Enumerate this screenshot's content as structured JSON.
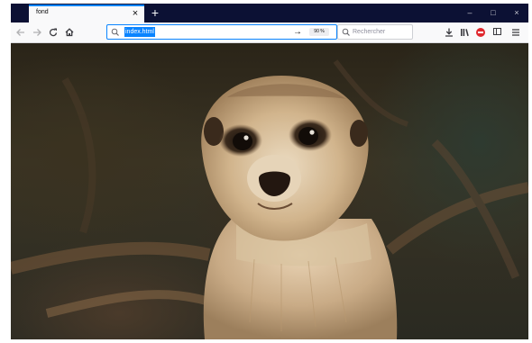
{
  "browser": {
    "tab": {
      "title": "fond",
      "close_label": "×"
    },
    "new_tab_label": "+",
    "window_controls": {
      "minimize": "–",
      "maximize": "□",
      "close": "×"
    },
    "nav": {
      "back_icon": "arrow-left-icon",
      "forward_icon": "arrow-right-icon",
      "reload_icon": "reload-icon",
      "home_icon": "home-icon"
    },
    "urlbar": {
      "value": "index.html",
      "go_label": "→",
      "zoom": "90 %"
    },
    "searchbar": {
      "placeholder": "Rechercher"
    },
    "toolbar": {
      "download_label": "⤓",
      "library_label": "⫼",
      "menu_label": "≡"
    }
  },
  "content": {
    "image_subject": "meerkat photo",
    "colors": {
      "accent": "#0a84ff",
      "titlebar": "#0c1134",
      "toolbar": "#f9f9fa"
    }
  }
}
